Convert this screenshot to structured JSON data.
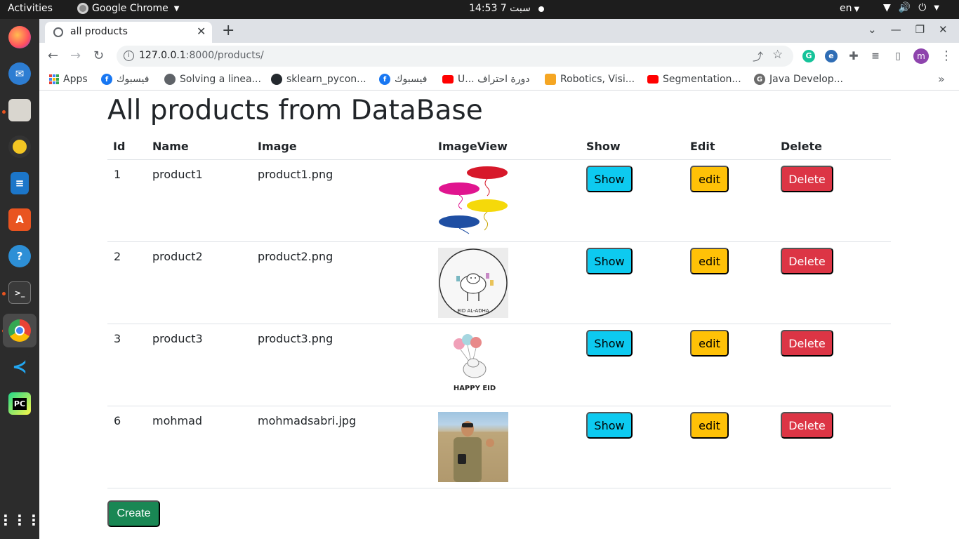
{
  "system_bar": {
    "activities": "Activities",
    "app_name": "Google Chrome",
    "clock": "14:53  7 سبت",
    "language": "en"
  },
  "dock": {
    "items": [
      "firefox-icon",
      "thunderbird-icon",
      "files-icon",
      "rhythmbox-icon",
      "writer-icon",
      "software-icon",
      "help-icon",
      "terminal-icon",
      "chrome-icon",
      "vscode-icon",
      "pycharm-icon",
      "show-apps-icon"
    ]
  },
  "browser": {
    "tab_title": "all products",
    "url_host": "127.0.0.1",
    "url_path": ":8000/products/",
    "profile_initial": "m",
    "bookmarks": [
      {
        "label": "Apps",
        "icon": "apps-grid-icon"
      },
      {
        "label": "فيسبوك",
        "icon": "facebook-icon"
      },
      {
        "label": "Solving a linea...",
        "icon": "globe-icon"
      },
      {
        "label": "sklearn_pycon...",
        "icon": "github-icon"
      },
      {
        "label": "فيسبوك",
        "icon": "facebook-icon"
      },
      {
        "label": "U... دورة احتراف",
        "icon": "youtube-icon"
      },
      {
        "label": "Robotics, Visi...",
        "icon": "udemy-icon"
      },
      {
        "label": "Segmentation...",
        "icon": "youtube-icon"
      },
      {
        "label": "Java Develop...",
        "icon": "geeks-icon"
      }
    ]
  },
  "page": {
    "title": "All products from DataBase",
    "headers": {
      "id": "Id",
      "name": "Name",
      "image": "Image",
      "image_view": "ImageView",
      "show": "Show",
      "edit": "Edit",
      "delete": "Delete"
    },
    "rows": [
      {
        "id": "1",
        "name": "product1",
        "image": "product1.png",
        "thumb": "balloons-image"
      },
      {
        "id": "2",
        "name": "product2",
        "image": "product2.png",
        "thumb": "eid-sheep-image"
      },
      {
        "id": "3",
        "name": "product3",
        "image": "product3.png",
        "thumb": "happy-eid-image"
      },
      {
        "id": "6",
        "name": "mohmad",
        "image": "mohmadsabri.jpg",
        "thumb": "person-photo-image"
      }
    ],
    "buttons": {
      "show": "Show",
      "edit": "edit",
      "delete": "Delete",
      "create": "Create"
    },
    "colors": {
      "show": "#0dcaf0",
      "edit": "#ffc107",
      "delete": "#dc3545",
      "create": "#198754"
    }
  },
  "thumb_text": {
    "eid": "EID AL-ADHA",
    "happy": "HAPPY EID"
  }
}
